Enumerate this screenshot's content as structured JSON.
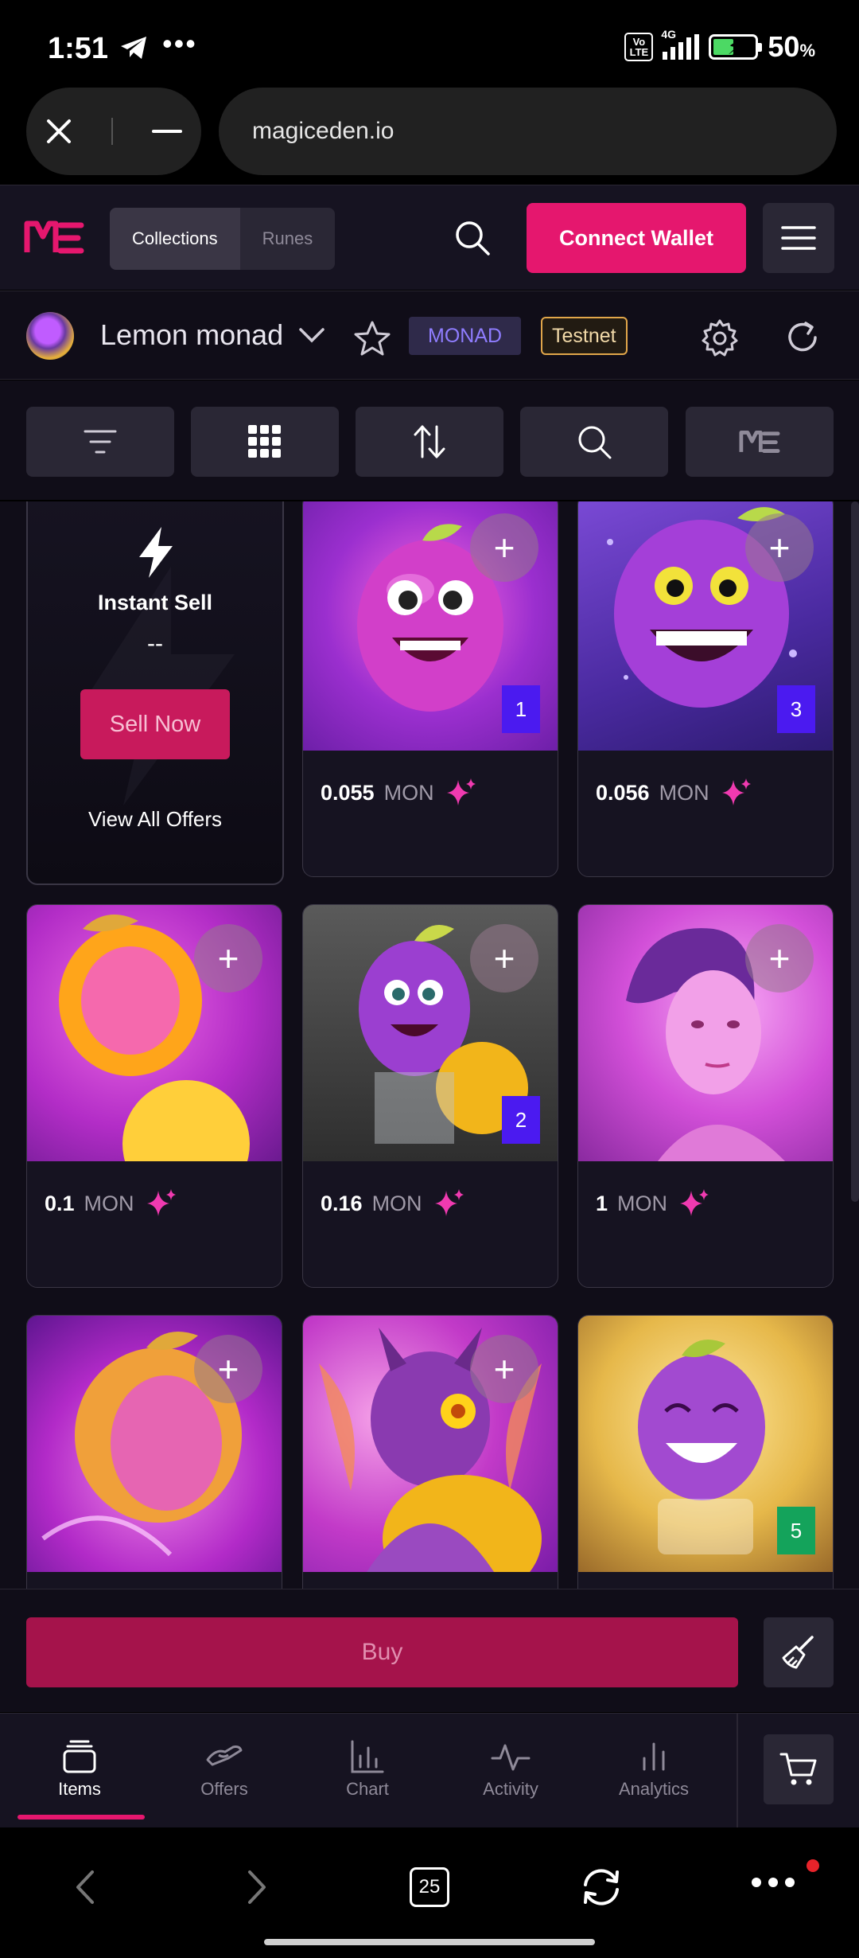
{
  "status_bar": {
    "time": "1:51",
    "dots": "•••",
    "volte": "Vo LTE",
    "network": "4G",
    "battery_pct": "50",
    "battery_unit": "%"
  },
  "browser": {
    "url": "magiceden.io",
    "tab_count": "25"
  },
  "header": {
    "tabs": [
      {
        "label": "Collections",
        "active": true
      },
      {
        "label": "Runes",
        "active": false
      }
    ],
    "connect_label": "Connect Wallet"
  },
  "collection": {
    "name": "Lemon monad",
    "chain_badge": "MONAD",
    "network_badge": "Testnet"
  },
  "instant_sell": {
    "title": "Instant Sell",
    "value": "--",
    "button": "Sell Now",
    "link": "View All Offers"
  },
  "items": [
    {
      "price": "0.055",
      "currency": "MON",
      "rank": "1"
    },
    {
      "price": "0.056",
      "currency": "MON",
      "rank": "3"
    },
    {
      "price": "0.1",
      "currency": "MON",
      "rank": ""
    },
    {
      "price": "0.16",
      "currency": "MON",
      "rank": "2"
    },
    {
      "price": "1",
      "currency": "MON",
      "rank": ""
    },
    {
      "price": "",
      "currency": "",
      "rank": ""
    },
    {
      "price": "",
      "currency": "",
      "rank": ""
    },
    {
      "price": "",
      "currency": "",
      "rank": "5"
    }
  ],
  "buy_label": "Buy",
  "bottom_nav": [
    {
      "label": "Items",
      "icon": "items-icon",
      "active": true
    },
    {
      "label": "Offers",
      "icon": "offers-icon",
      "active": false
    },
    {
      "label": "Chart",
      "icon": "chart-icon",
      "active": false
    },
    {
      "label": "Activity",
      "icon": "activity-icon",
      "active": false
    },
    {
      "label": "Analytics",
      "icon": "analytics-icon",
      "active": false
    }
  ],
  "colors": {
    "brand_pink": "#e5176e",
    "background": "#100d18",
    "rank_purple": "#4b1af0",
    "rank_green": "#14a35b"
  }
}
